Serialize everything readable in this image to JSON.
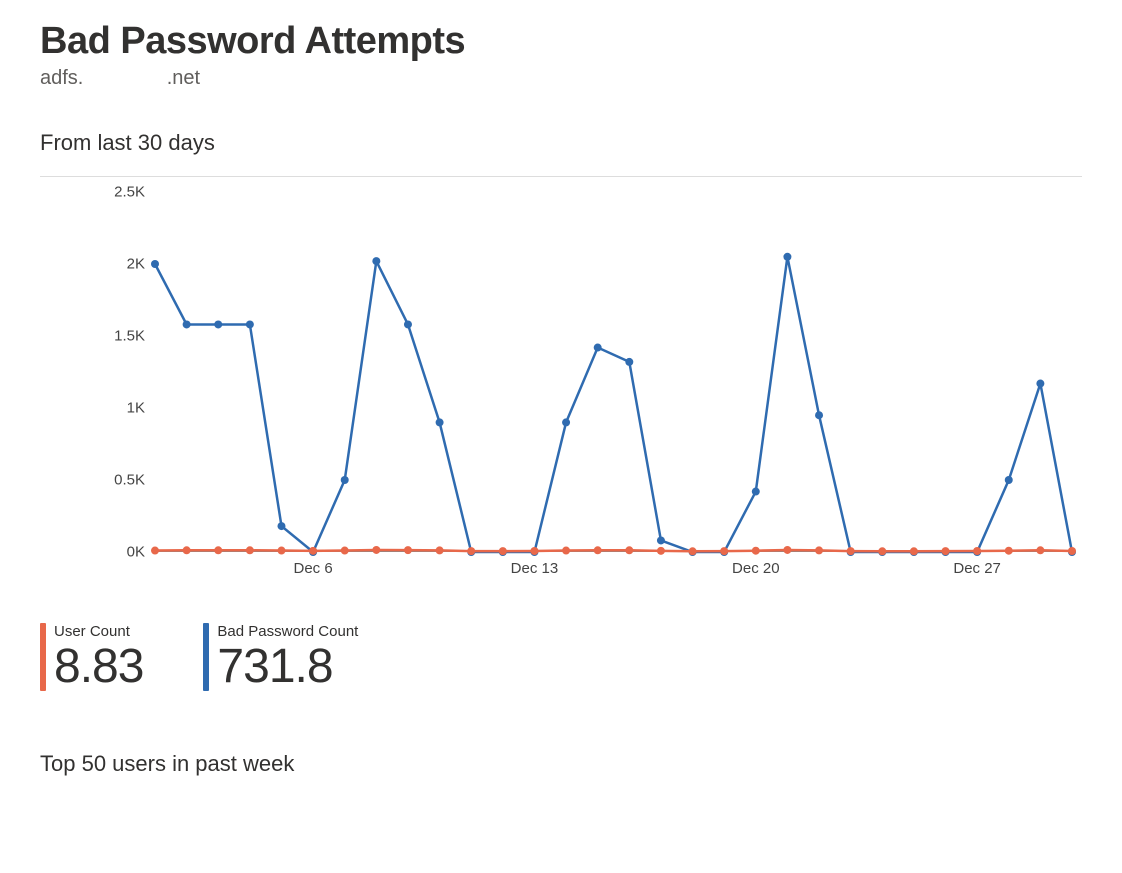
{
  "title": "Bad Password Attempts",
  "subtitle_prefix": "adfs.",
  "subtitle_suffix": ".net",
  "period_label": "From last 30 days",
  "metrics": {
    "user_count": {
      "label": "User Count",
      "value": "8.83",
      "color": "#E8684A"
    },
    "bad_pw_count": {
      "label": "Bad Password Count",
      "value": "731.8",
      "color": "#2F6BB0"
    }
  },
  "section2_title": "Top 50 users in past week",
  "chart_data": {
    "type": "line",
    "ylabel": "",
    "xlabel": "",
    "ylim": [
      0,
      2500
    ],
    "yticks": [
      0,
      500,
      1000,
      1500,
      2000,
      2500
    ],
    "ytick_labels": [
      "0K",
      "0.5K",
      "1K",
      "1.5K",
      "2K",
      "2.5K"
    ],
    "x_index": [
      0,
      1,
      2,
      3,
      4,
      5,
      6,
      7,
      8,
      9,
      10,
      11,
      12,
      13,
      14,
      15,
      16,
      17,
      18,
      19,
      20,
      21,
      22,
      23,
      24,
      25,
      26,
      27,
      28,
      29
    ],
    "xtick_index": [
      5,
      12,
      19,
      26
    ],
    "xtick_labels": [
      "Dec 6",
      "Dec 13",
      "Dec 20",
      "Dec 27"
    ],
    "series": [
      {
        "name": "Bad Password Count",
        "color": "#2F6BB0",
        "values": [
          2000,
          1580,
          1580,
          1580,
          180,
          0,
          500,
          2020,
          1580,
          900,
          0,
          0,
          0,
          900,
          1420,
          1320,
          80,
          0,
          0,
          420,
          2050,
          950,
          0,
          0,
          0,
          0,
          0,
          500,
          1170,
          0
        ]
      },
      {
        "name": "User Count",
        "color": "#E8684A",
        "values": [
          10,
          12,
          12,
          12,
          10,
          8,
          10,
          14,
          13,
          11,
          6,
          6,
          7,
          10,
          12,
          12,
          8,
          5,
          6,
          9,
          14,
          11,
          6,
          5,
          5,
          6,
          7,
          9,
          12,
          7
        ]
      }
    ]
  }
}
